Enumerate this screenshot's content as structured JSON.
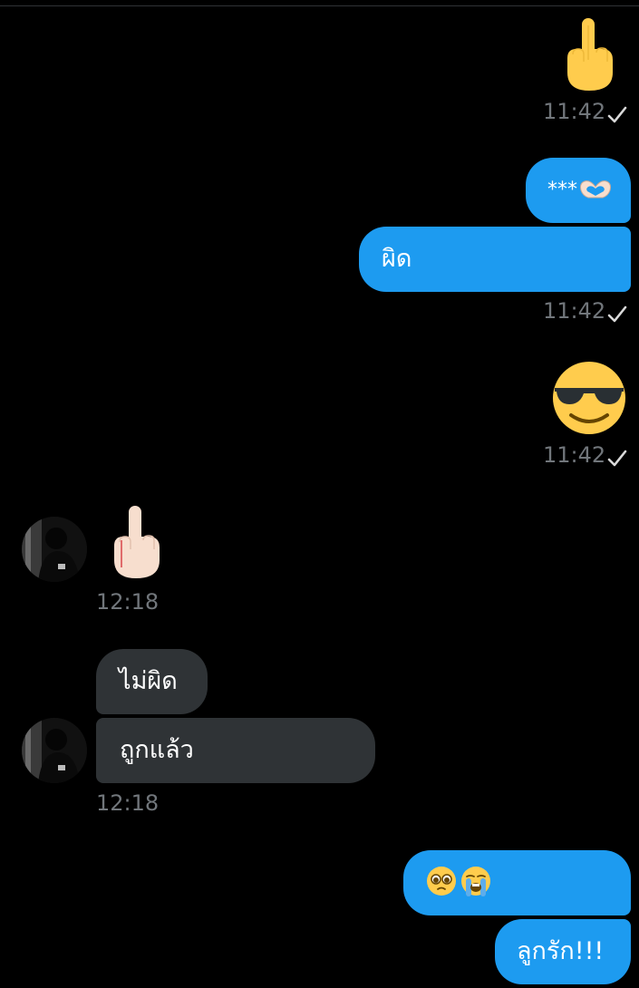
{
  "theme": {
    "background": "#000000",
    "outgoing_bubble": "#1d9bf0",
    "incoming_bubble": "#2f3336",
    "timestamp_color": "#71767b"
  },
  "messages": [
    {
      "direction": "outgoing",
      "kind": "emoji",
      "icon": "middle-finger-yellow-icon",
      "time": "11:42",
      "status_icon": "sent-check-icon"
    },
    {
      "direction": "outgoing",
      "kind": "text",
      "text": "***",
      "trailing_icon": "heart-hands-icon"
    },
    {
      "direction": "outgoing",
      "kind": "text",
      "text": "ผิด",
      "time": "11:42",
      "status_icon": "sent-check-icon"
    },
    {
      "direction": "outgoing",
      "kind": "emoji",
      "icon": "sunglasses-face-icon",
      "time": "11:42",
      "status_icon": "sent-check-icon"
    },
    {
      "direction": "incoming",
      "kind": "emoji",
      "icon": "middle-finger-light-skin-icon",
      "time": "12:18",
      "avatar": "contact-avatar"
    },
    {
      "direction": "incoming",
      "kind": "text",
      "text": "ไม่ผิด"
    },
    {
      "direction": "incoming",
      "kind": "text",
      "text": "ถูกแล้ว",
      "time": "12:18",
      "avatar": "contact-avatar"
    },
    {
      "direction": "outgoing",
      "kind": "emoji-text",
      "icons": [
        "pleading-face-icon",
        "loudly-crying-face-icon"
      ]
    },
    {
      "direction": "outgoing",
      "kind": "text",
      "text": "ลูกรัก!!!"
    }
  ]
}
